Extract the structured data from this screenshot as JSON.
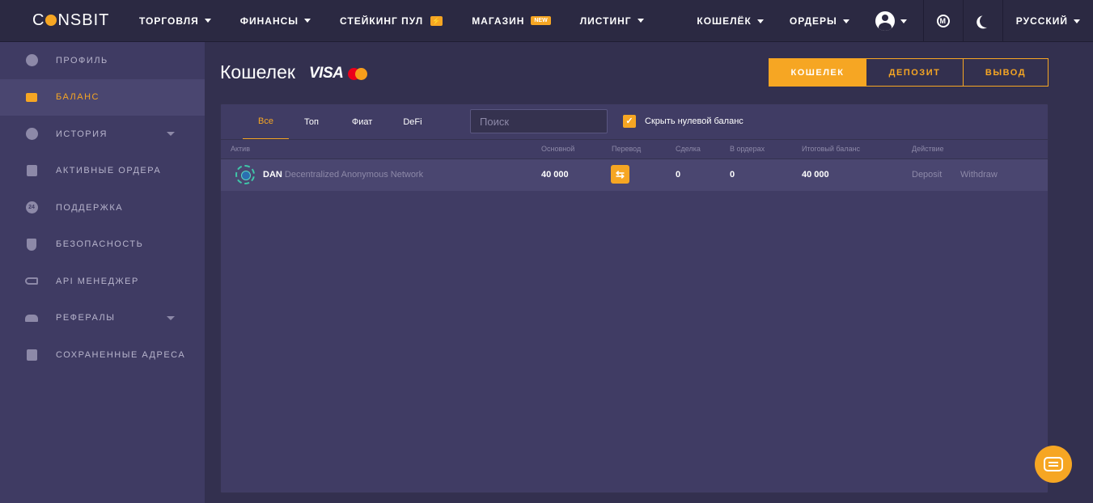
{
  "brand": {
    "logo_text_a": "C",
    "logo_text_b": "NSBIT"
  },
  "topnav": {
    "items": [
      {
        "label": "ТОРГОВЛЯ"
      },
      {
        "label": "ФИНАНСЫ"
      },
      {
        "label": "СТЕЙКИНГ ПУЛ"
      },
      {
        "label": "МАГАЗИН",
        "badge": "NEW"
      },
      {
        "label": "ЛИСТИНГ"
      }
    ],
    "wallet_menu": "КОШЕЛЁК",
    "orders_menu": "ОРДЕРЫ",
    "m_icon": "M",
    "language": "РУССКИЙ"
  },
  "sidebar": {
    "items": [
      {
        "label": "ПРОФИЛЬ",
        "icon": "user-icon"
      },
      {
        "label": "БАЛАНС",
        "icon": "wallet-icon",
        "active": true
      },
      {
        "label": "ИСТОРИЯ",
        "icon": "clock-icon"
      },
      {
        "label": "АКТИВНЫЕ ОРДЕРА",
        "icon": "orders-icon"
      },
      {
        "label": "ПОДДЕРЖКА",
        "icon": "support-24-icon",
        "icon_text": "24"
      },
      {
        "label": "БЕЗОПАСНОСТЬ",
        "icon": "shield-icon"
      },
      {
        "label": "API МЕНЕДЖЕР",
        "icon": "key-icon"
      },
      {
        "label": "РЕФЕРАЛЫ",
        "icon": "users-icon"
      },
      {
        "label": "СОХРАНЕННЫЕ АДРЕСА",
        "icon": "calendar-icon"
      }
    ]
  },
  "main": {
    "title": "Кошелек",
    "visa": "VISA",
    "actions": {
      "wallet": "КОШЕЛЕК",
      "deposit": "ДЕПОЗИТ",
      "withdraw": "ВЫВОД"
    }
  },
  "filters": {
    "tabs": [
      "Все",
      "Топ",
      "Фиат",
      "DeFi"
    ],
    "search_placeholder": "Поиск",
    "hide_zero_label": "Скрыть нулевой баланс",
    "hide_zero_checked": true
  },
  "table": {
    "headers": {
      "asset": "Актив",
      "main": "Основной",
      "transfer": "Перевод",
      "trade": "Сделка",
      "in_orders": "В ордерах",
      "total": "Итоговый баланс",
      "action": "Действие"
    },
    "rows": [
      {
        "symbol": "DAN",
        "name": "Decentralized Anonymous Network",
        "main": "40 000",
        "transfer_icon": "⇆",
        "trade": "0",
        "in_orders": "0",
        "total": "40 000",
        "deposit": "Deposit",
        "withdraw": "Withdraw"
      }
    ]
  },
  "colors": {
    "accent": "#f6a623",
    "background": "#33304f",
    "panel": "#403c64",
    "sidebar": "#3f3b63",
    "topbar": "#2b2942"
  }
}
